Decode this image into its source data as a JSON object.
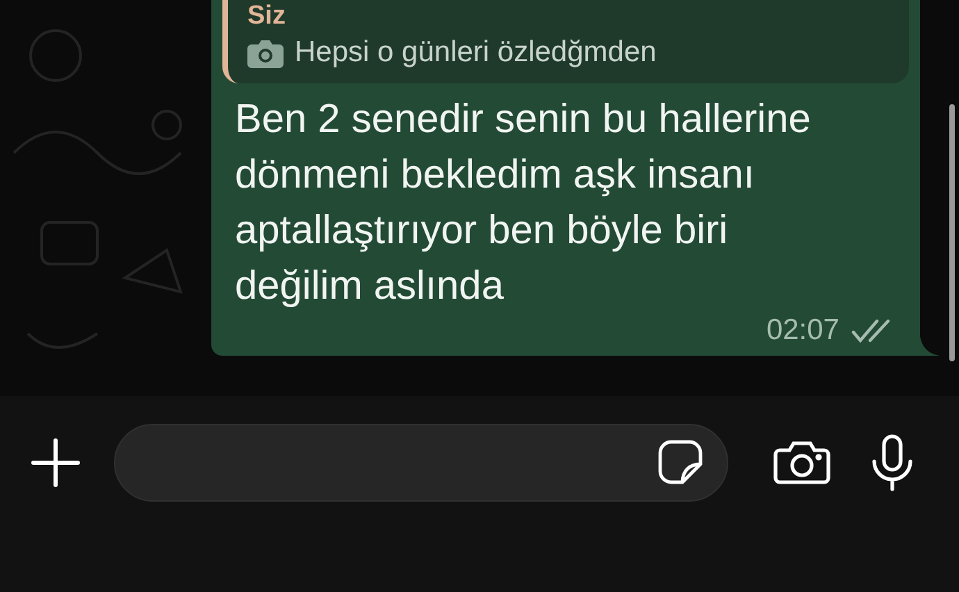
{
  "message": {
    "quote": {
      "author": "Siz",
      "text": "Hepsi o günleri özledğmden"
    },
    "text": "Ben 2 senedir senin bu hallerine dönmeni bekledim aşk insanı aptallaştırıyor ben böyle biri değilim aslında",
    "time": "02:07",
    "read": false
  }
}
